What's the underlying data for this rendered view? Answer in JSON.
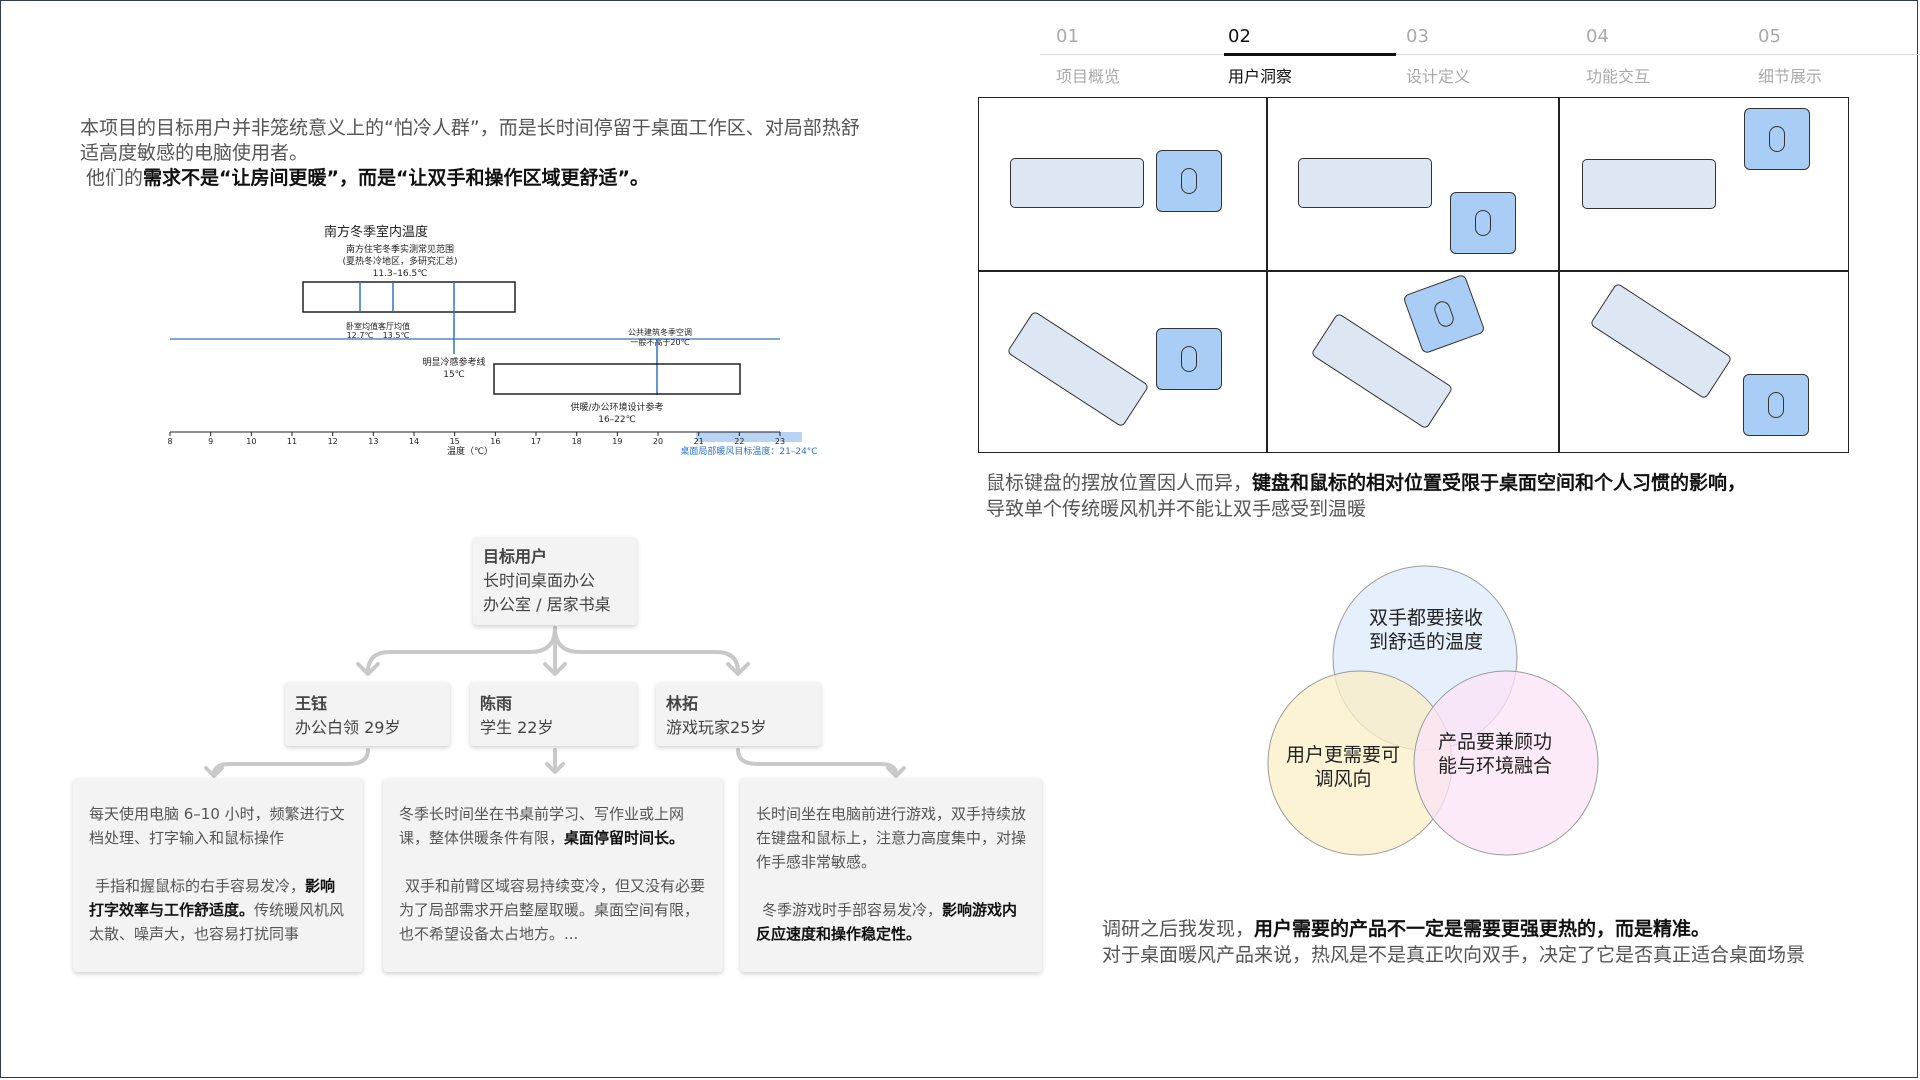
{
  "tabs": [
    {
      "num": "01",
      "label": "项目概览"
    },
    {
      "num": "02",
      "label": "用户洞察"
    },
    {
      "num": "03",
      "label": "设计定义"
    },
    {
      "num": "04",
      "label": "功能交互"
    },
    {
      "num": "05",
      "label": "细节展示"
    }
  ],
  "intro": {
    "line1": "本项目的目标用户并非笼统意义上的“怕冷人群”，而是长时间停留于桌面工作区、对局部热舒适高度敏感的电脑使用者。",
    "line2_prefix": "他们的",
    "line2_bold": "需求不是“让房间更暖”，而是“让双手和操作区域更舒适”。"
  },
  "temp_chart": {
    "title": "南方冬季室内温度",
    "range1_label": "南方住宅冬季实测常见范围",
    "range1_sub": "(夏热冬冷地区，多研究汇总)",
    "range1_value": "11.3–16.5℃",
    "bedroom_label": "卧室均值",
    "living_label": "客厅均值",
    "bedroom_value": "12.7℃",
    "living_value": "13.5℃",
    "public_label": "公共建筑冬季空调",
    "public_value": "一般不高于20℃",
    "cold_label": "明显冷感参考线",
    "cold_value": "15℃",
    "office_label": "供暖/办公环境设计参考",
    "office_value": "16–22℃",
    "axis_label": "温度（℃）",
    "target_label": "桌面局部暖风目标温度：21–24°C",
    "ticks": [
      "8",
      "9",
      "10",
      "11",
      "12",
      "13",
      "14",
      "15",
      "16",
      "17",
      "18",
      "19",
      "20",
      "21",
      "22",
      "23"
    ]
  },
  "tree": {
    "root": {
      "title": "目标用户",
      "line1": "长时间桌面办公",
      "line2": "办公室 / 居家书桌"
    },
    "persons": [
      {
        "name": "王钰",
        "info": "办公白领  29岁"
      },
      {
        "name": "陈雨",
        "info": "学生  22岁"
      },
      {
        "name": "林拓",
        "info": "游戏玩家25岁"
      }
    ],
    "descs": [
      {
        "p1": "每天使用电脑 6–10 小时，频繁进行文档处理、打字输入和鼠标操作",
        "p2_pre": "手指和握鼠标的右手容易发冷，",
        "p2_bold": "影响打字效率与工作舒适度。",
        "p2_post": "传统暖风机风太散、噪声大，也容易打扰同事"
      },
      {
        "p1_pre": "冬季长时间坐在书桌前学习、写作业或上网课，整体供暖条件有限，",
        "p1_bold": "桌面停留时间长。",
        "p2": "双手和前臂区域容易持续变冷，但又没有必要为了局部需求开启整屋取暖。桌面空间有限，也不希望设备太占地方。..."
      },
      {
        "p1": "长时间坐在电脑前进行游戏，双手持续放在键盘和鼠标上，注意力高度集中，对操作手感非常敏感。",
        "p2_pre": "冬季游戏时手部容易发冷，",
        "p2_bold": "影响游戏内反应速度和操作稳定性。"
      }
    ]
  },
  "grid_caption": {
    "pre": "鼠标键盘的摆放位置因人而异，",
    "bold": "键盘和鼠标的相对位置受限于桌面空间和个人习惯的影响，",
    "line2": "导致单个传统暖风机并不能让双手感受到温暖"
  },
  "venn": {
    "top": "双手都要接收到舒适的温度",
    "left": "用户更需要可调风向",
    "right": "产品要兼顾功能与环境融合",
    "colors": {
      "top": "#dcebfb",
      "left": "#fbeec6",
      "right": "#fbe3f7"
    }
  },
  "conclusion": {
    "pre": "调研之后我发现，",
    "bold": "用户需要的产品不一定是需要更强更热的，而是精准。",
    "line2": "对于桌面暖风产品来说，热风是不是真正吹向双手，决定了它是否真正适合桌面场景"
  }
}
